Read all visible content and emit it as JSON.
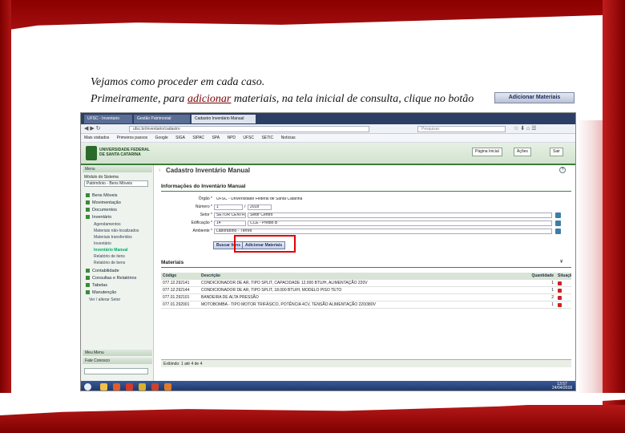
{
  "slide": {
    "intro_text": "Vejamos como proceder em cada caso.",
    "instr_prefix": "Primeiramente, para ",
    "instr_emph": "adicionar",
    "instr_suffix": " materiais, na tela inicial de consulta, clique no botão",
    "button_label": "Adicionar Materiais"
  },
  "browser": {
    "tabs": [
      "UFSC - Inventario",
      "Gestão Patrimonial",
      "Cadastro Inventário Manual"
    ],
    "url": "ufsc.br/inventario/cadastro",
    "search_placeholder": "Pesquisar",
    "bookmarks": [
      "Mais visitados",
      "Primeiros passos",
      "Google",
      "SIGA",
      "SIPAC",
      "SPA",
      "NPD",
      "UFSC",
      "SETIC",
      "Notícias"
    ]
  },
  "app": {
    "university": "UNIVERSIDADE FEDERAL DE SANTA CATARINA",
    "header_buttons": [
      "Página Inicial",
      "Ações",
      "Sair"
    ]
  },
  "sidebar": {
    "menu_label": "Menu",
    "module_label": "Módulo do Sistema",
    "module_value": "Patrimônio - Bens Móveis",
    "groups": [
      {
        "label": "Bens Móveis"
      },
      {
        "label": "Movimentação"
      },
      {
        "label": "Documentos"
      },
      {
        "label": "Inventário"
      }
    ],
    "inventario_items": [
      "Agendamentos",
      "Materiais não-localizados",
      "Materiais transferidos",
      "Inventário",
      "Inventário Manual",
      "Relatório de itens",
      "Relatório de bens"
    ],
    "groups2": [
      {
        "label": "Contabilidade"
      },
      {
        "label": "Consultas e Relatórios"
      },
      {
        "label": "Tabelas"
      },
      {
        "label": "Manutenção"
      }
    ],
    "extra_link": "Ver / alterar Setor",
    "footer1": "Meu Menu",
    "footer2": "Fale Conosco"
  },
  "main": {
    "page_title": "Cadastro Inventário Manual",
    "section_info": "Informações do Inventário Manual",
    "fields": [
      {
        "label": "Órgão *",
        "value": "UFSC - Universidade Federal de Santa Catarina"
      },
      {
        "label": "Número *",
        "value": "1",
        "value2": "2018"
      },
      {
        "label": "Setor *",
        "value": "SETOR CENTRO",
        "value2": "Setor Centro"
      },
      {
        "label": "Edificação *",
        "value": "14",
        "value2": "CCE - Prédio B"
      },
      {
        "label": "Ambiente *",
        "value": "Laboratório - Térreo"
      }
    ],
    "buttons": {
      "search": "Buscar Itens",
      "add": "Adicionar Materiais"
    },
    "section_materials": "Materiais",
    "table": {
      "headers": [
        "Código",
        "Descrição",
        "Quantidade",
        "Situação"
      ],
      "rows": [
        {
          "code": "077.12.292141",
          "desc": "CONDICIONADOR DE AR, TIPO SPLIT, CAPACIDADE 12.000 BTU/H, ALIMENTAÇÃO 220V",
          "qty": "1"
        },
        {
          "code": "077.12.292144",
          "desc": "CONDICIONADOR DE AR, TIPO SPLIT, 18.000 BTU/H, MODELO PISO TETO",
          "qty": "1"
        },
        {
          "code": "077.01.292101",
          "desc": "BANDEIRA DE ALTA PRESSÃO",
          "qty": "2"
        },
        {
          "code": "077.01.292001",
          "desc": "MOTOBOMBA - TIPO MOTOR TRIFÁSICO, POTÊNCIA 4CV, TENSÃO ALIMENTAÇÃO 220/380V",
          "qty": "1"
        }
      ]
    },
    "footer_text": "Exibindo: 1 até 4 de 4"
  },
  "taskbar": {
    "time": "13:57",
    "date": "24/04/2018"
  }
}
